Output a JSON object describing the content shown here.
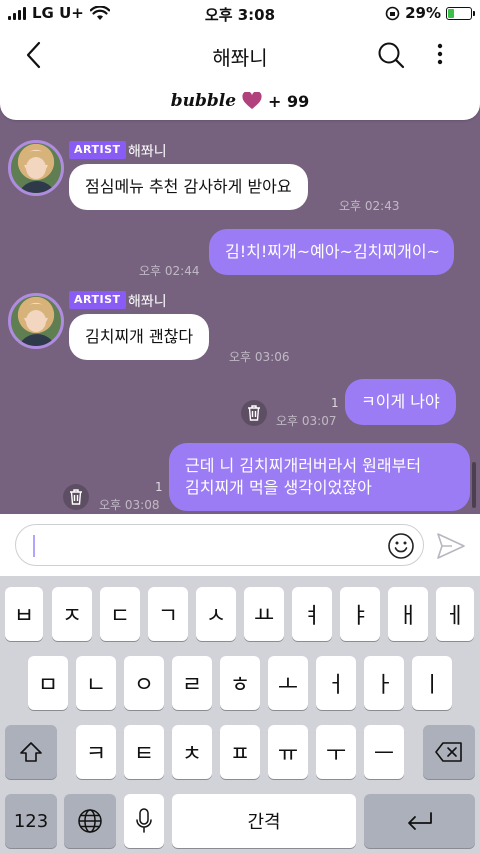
{
  "status_bar": {
    "carrier": "LG U+",
    "time": "오후 3:08",
    "battery": "29%",
    "battery_level": 0.29
  },
  "header": {
    "title": "해쫘니"
  },
  "banner": {
    "logo": "bubble",
    "count": "+ 99"
  },
  "messages": [
    {
      "badge": "ARTIST",
      "sender": "해쫘니",
      "text": "점심메뉴 추천 감사하게 받아요",
      "time": "오후 02:43"
    },
    {
      "text": "김!치!찌개~예아~김치찌개이~",
      "time": "오후 02:44"
    },
    {
      "badge": "ARTIST",
      "sender": "해쫘니",
      "text": "김치찌개 괜찮다",
      "time": "오후 03:06"
    },
    {
      "text": "ㅋ이게 나야",
      "time": "오후 03:07",
      "read": "1"
    },
    {
      "line1": "근데 니 김치찌개러버라서 원래부터",
      "line2": "김치찌개 먹을 생각이었잖아",
      "time": "오후 03:08",
      "read": "1"
    }
  ],
  "input": {
    "placeholder": ""
  },
  "keyboard": {
    "row1": [
      "ㅂ",
      "ㅈ",
      "ㄷ",
      "ㄱ",
      "ㅅ",
      "ㅛ",
      "ㅕ",
      "ㅑ",
      "ㅐ",
      "ㅔ"
    ],
    "row2": [
      "ㅁ",
      "ㄴ",
      "ㅇ",
      "ㄹ",
      "ㅎ",
      "ㅗ",
      "ㅓ",
      "ㅏ",
      "ㅣ"
    ],
    "row3": [
      "ㅋ",
      "ㅌ",
      "ㅊ",
      "ㅍ",
      "ㅠ",
      "ㅜ",
      "ㅡ"
    ],
    "numbers_key": "123",
    "space_key": "간격"
  }
}
